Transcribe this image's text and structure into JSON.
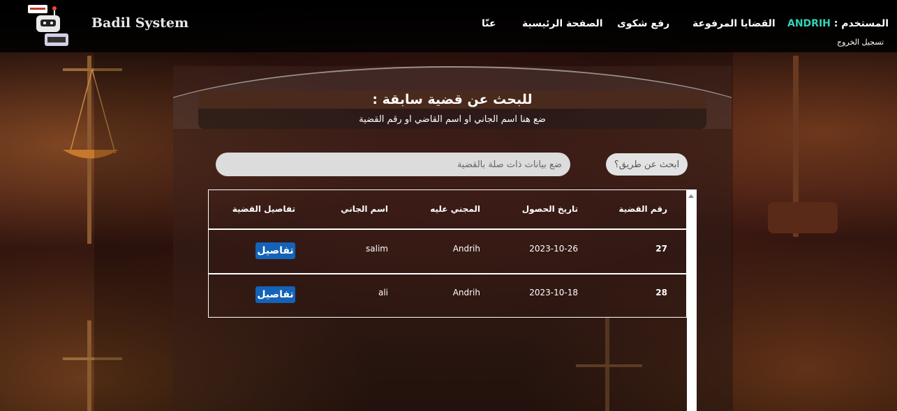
{
  "header": {
    "brand": "Badil System",
    "nav": {
      "about": "عنّا",
      "home": "الصفحة الرئيسية",
      "complaint": "رفع شكوى",
      "cases": "القضايا المرفوعة"
    },
    "user_label": "المستخدم :",
    "user_name": "ANDRIH",
    "logout": "تسجيل الخروج"
  },
  "main": {
    "title": "للبحث عن قضية سابقة :",
    "subtitle": "ضع هنا اسم الجاني او اسم القاضي او رقم القضية",
    "search_button": "ابحث عن طريق؟",
    "search_placeholder": "ضع بيانات ذات صلة بالقضية"
  },
  "table": {
    "headers": [
      "رقم القضية",
      "تاريخ الحصول",
      "المجني عليه",
      "اسم الجاني",
      "تفاصيل القضية"
    ],
    "rows": [
      {
        "case_no": "27",
        "date": "2023-10-26",
        "victim": "Andrih",
        "offender": "salim",
        "details": "تفاصيل"
      },
      {
        "case_no": "28",
        "date": "2023-10-18",
        "victim": "Andrih",
        "offender": "ali",
        "details": "تفاصيل"
      }
    ]
  },
  "colors": {
    "accent_user": "#2fd6b8",
    "details_button": "#1463b8",
    "title_bar": "#4a2a1c"
  }
}
